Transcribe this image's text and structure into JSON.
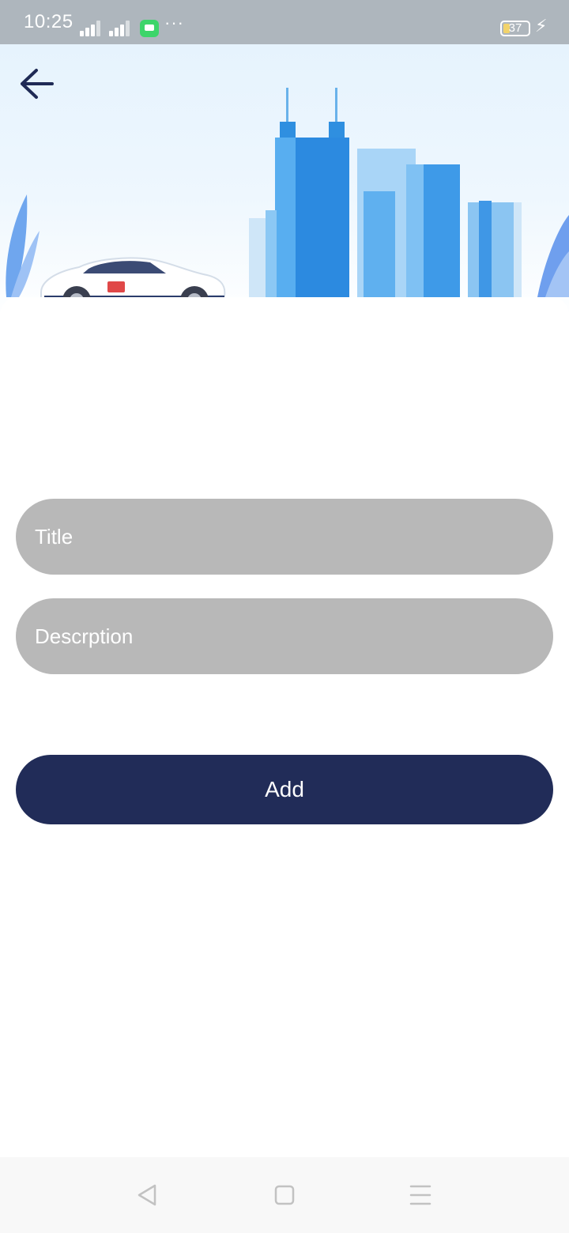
{
  "status_bar": {
    "time": "10:25",
    "battery_level": "37",
    "icons": [
      "signal-icon",
      "signal-icon",
      "message-icon",
      "more-icon",
      "battery-icon",
      "charging-icon"
    ]
  },
  "header": {
    "back_icon": "arrow-left-icon",
    "illustration": [
      "city-skyline",
      "car",
      "plant"
    ]
  },
  "form": {
    "title_placeholder": "Title",
    "description_placeholder": "Descrption",
    "add_label": "Add"
  },
  "nav_bar": {
    "icons": [
      "nav-back-icon",
      "nav-home-icon",
      "nav-menu-icon"
    ]
  },
  "colors": {
    "status_bar": "#aeb6bd",
    "input_background": "#b8b8b8",
    "button_primary": "#212c58",
    "icon_dark": "#1f2a55"
  }
}
